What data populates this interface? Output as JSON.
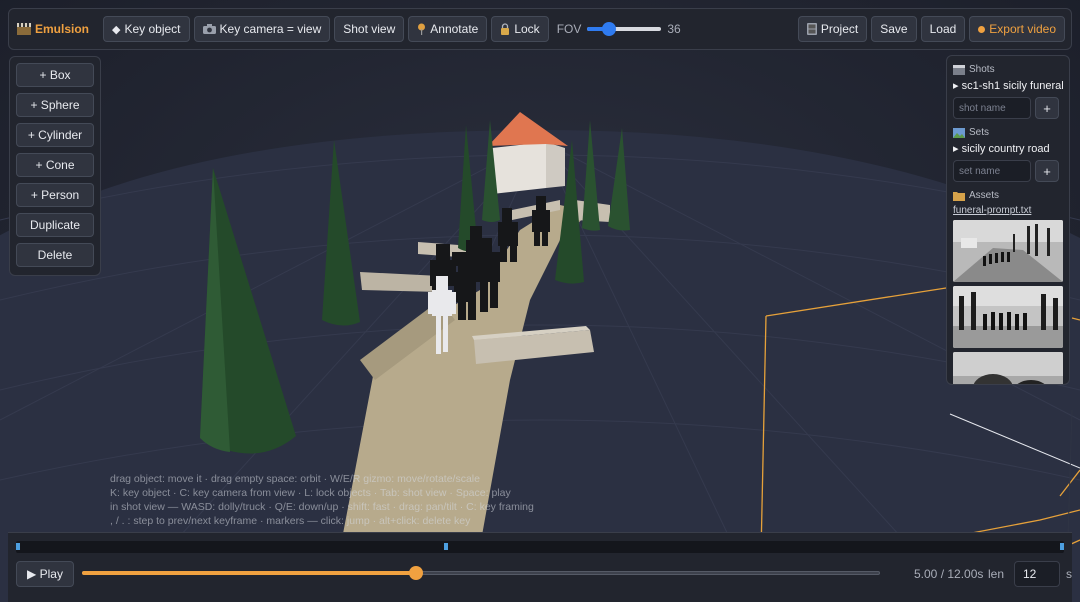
{
  "app": {
    "title": "Emulsion",
    "logo_icon": "clapperboard-icon"
  },
  "toolbar": {
    "key_object": "Key object",
    "key_camera": "Key camera = view",
    "shot_view": "Shot view",
    "annotate": "Annotate",
    "lock": "Lock",
    "fov_label": "FOV",
    "fov_value": "36",
    "fov_fraction": 0.25,
    "project": "Project",
    "save": "Save",
    "load": "Load",
    "export": "Export video"
  },
  "tools": {
    "box": "+ Box",
    "sphere": "+ Sphere",
    "cylinder": "+ Cylinder",
    "cone": "+ Cone",
    "person": "+ Person",
    "duplicate": "Duplicate",
    "delete": "Delete"
  },
  "library": {
    "shots": {
      "heading": "Shots",
      "items": [
        "▸ sc1-sh1 sicily funeral"
      ],
      "placeholder": "shot name",
      "add": "+"
    },
    "sets": {
      "heading": "Sets",
      "items": [
        "▸ sicily country road"
      ],
      "placeholder": "set name",
      "add": "+"
    },
    "assets": {
      "heading": "Assets",
      "file": "funeral-prompt.txt"
    }
  },
  "help": [
    "drag object: move it · drag empty space: orbit · W/E/R gizmo: move/rotate/scale",
    "K: key object · C: key camera from view · L: lock objects · Tab: shot view · Space: play",
    "in shot view — WASD: dolly/truck · Q/E: down/up · shift: fast · drag: pan/tilt · C: key framing",
    ", / . : step to prev/next keyframe · markers — click: jump · alt+click: delete key"
  ],
  "timeline": {
    "play": "▶ Play",
    "time_readout": "5.00 / 12.00s",
    "current": 5.0,
    "duration": 12.0,
    "len_label": "len",
    "len_value": "12",
    "unit": "s",
    "keyframes": [
      0.0,
      0.41,
      1.0
    ]
  },
  "colors": {
    "accent": "#f0a140",
    "slider_blue": "#2f7bf0",
    "key_marker": "#4d9fe0"
  }
}
